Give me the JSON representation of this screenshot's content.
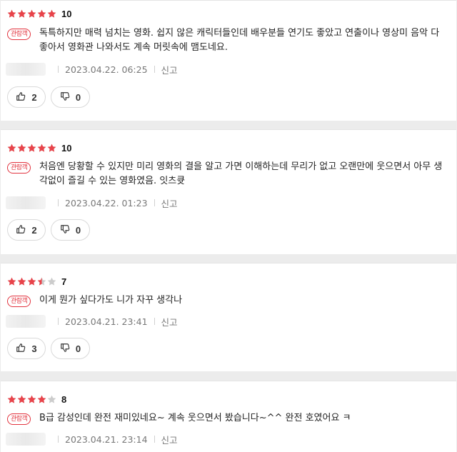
{
  "reviews": [
    {
      "stars": 5,
      "score": "10",
      "badge": "관람객",
      "text": "독특하지만 매력 넘치는 영화. 쉽지 않은 캐릭터들인데 배우분들 연기도 좋았고 연출이나 영상미 음악 다 좋아서 영화관 나와서도 계속 머릿속에 맴도네요.",
      "date": "2023.04.22. 06:25",
      "report": "신고",
      "likes": "2",
      "dislikes": "0"
    },
    {
      "stars": 5,
      "score": "10",
      "badge": "관람객",
      "text": "처음엔 당황할 수 있지만 미리 영화의 결을 알고 가면 이해하는데 무리가 없고 오랜만에 웃으면서 아무 생각없이 즐길 수 있는 영화였음. 잇츠큣",
      "date": "2023.04.22. 01:23",
      "report": "신고",
      "likes": "2",
      "dislikes": "0"
    },
    {
      "stars": 3.5,
      "score": "7",
      "badge": "관람객",
      "text": "이게 뭔가 싶다가도 니가 자꾸 생각나",
      "date": "2023.04.21. 23:41",
      "report": "신고",
      "likes": "3",
      "dislikes": "0"
    },
    {
      "stars": 4,
      "score": "8",
      "badge": "관람객",
      "text": "B급 감성인데 완전 재미있네요~ 계속 웃으면서 봤습니다~^^ 완전 호였어요 ㅋ",
      "date": "2023.04.21. 23:14",
      "report": "신고"
    }
  ],
  "colors": {
    "star": "#e8434a",
    "star_empty": "#cccccc",
    "badge": "#e2333e"
  },
  "icons": {
    "like": "thumbs-up-icon",
    "dislike": "thumbs-down-icon",
    "star": "star-icon"
  }
}
